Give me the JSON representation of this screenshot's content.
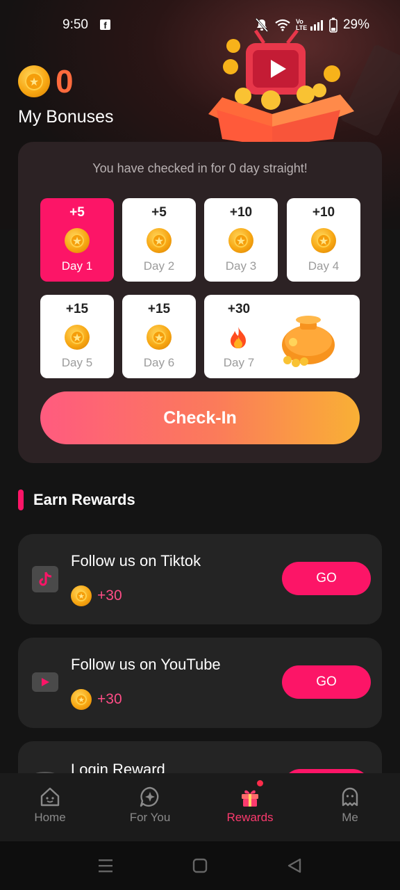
{
  "status_bar": {
    "time": "9:50",
    "battery": "29%",
    "network": "Vo LTE"
  },
  "bonuses": {
    "value": "0",
    "label": "My Bonuses"
  },
  "checkin": {
    "streak_text": "You have checked in for 0 day straight!",
    "days": [
      {
        "amount": "+5",
        "label": "Day 1"
      },
      {
        "amount": "+5",
        "label": "Day 2"
      },
      {
        "amount": "+10",
        "label": "Day 3"
      },
      {
        "amount": "+10",
        "label": "Day 4"
      },
      {
        "amount": "+15",
        "label": "Day 5"
      },
      {
        "amount": "+15",
        "label": "Day 6"
      },
      {
        "amount": "+30",
        "label": "Day 7"
      }
    ],
    "button_label": "Check-In"
  },
  "earn": {
    "title": "Earn Rewards",
    "tasks": [
      {
        "title": "Follow us on Tiktok",
        "reward": "+30",
        "button": "GO"
      },
      {
        "title": "Follow us on YouTube",
        "reward": "+30",
        "button": "GO"
      },
      {
        "title": "Login Reward",
        "reward": "",
        "button": ""
      }
    ]
  },
  "nav": {
    "items": [
      {
        "label": "Home"
      },
      {
        "label": "For You"
      },
      {
        "label": "Rewards"
      },
      {
        "label": "Me"
      }
    ]
  },
  "colors": {
    "accent": "#fc1567",
    "bonus_value": "#ff6b3d",
    "reward_text": "#ff4d86"
  }
}
